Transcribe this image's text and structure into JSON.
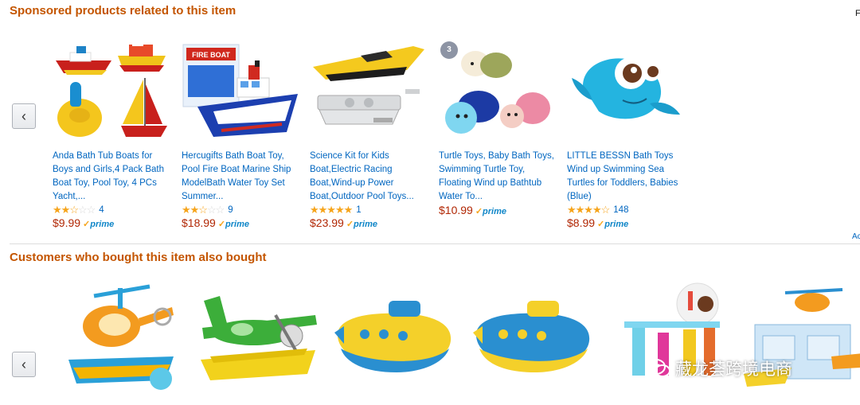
{
  "sponsored": {
    "title": "Sponsored products related to this item",
    "edge_text": "F",
    "edge_link": "Ac",
    "prev_label": "‹",
    "items": [
      {
        "title": "Anda Bath Tub Boats for Boys and Girls,4 Pack Bath Boat Toy, Pool Toy, 4 PCs Yacht,...",
        "stars": 2.5,
        "reviews": "4",
        "price": "$9.99",
        "prime": "prime"
      },
      {
        "title": "Hercugifts Bath Boat Toy, Pool Fire Boat Marine Ship ModelBath Water Toy Set Summer...",
        "stars": 2.5,
        "reviews": "9",
        "price": "$18.99",
        "prime": "prime",
        "box_text": "FIRE BOAT"
      },
      {
        "title": "Science Kit for Kids Boat,Electric Racing Boat,Wind-up Power Boat,Outdoor Pool Toys...",
        "stars": 5,
        "reviews": "1",
        "price": "$23.99",
        "prime": "prime"
      },
      {
        "title": "Turtle Toys, Baby Bath Toys, Swimming Turtle Toy, Floating Wind up Bathtub Water To...",
        "stars": null,
        "reviews": "",
        "price": "$10.99",
        "prime": "prime",
        "badge": "3"
      },
      {
        "title": "LITTLE BESSN Bath Toys Wind up Swimming Sea Turtles for Toddlers, Babies (Blue)",
        "stars": 4.5,
        "reviews": "148",
        "price": "$8.99",
        "prime": "prime"
      }
    ]
  },
  "also_bought": {
    "title": "Customers who bought this item also bought",
    "prev_label": "‹"
  },
  "watermark": {
    "text": "藏龙荟跨境电商"
  },
  "colors": {
    "section_title": "#c45500",
    "link": "#0066c0",
    "price": "#b12704",
    "star": "#f6a41b",
    "prime": "#0f86c8"
  }
}
